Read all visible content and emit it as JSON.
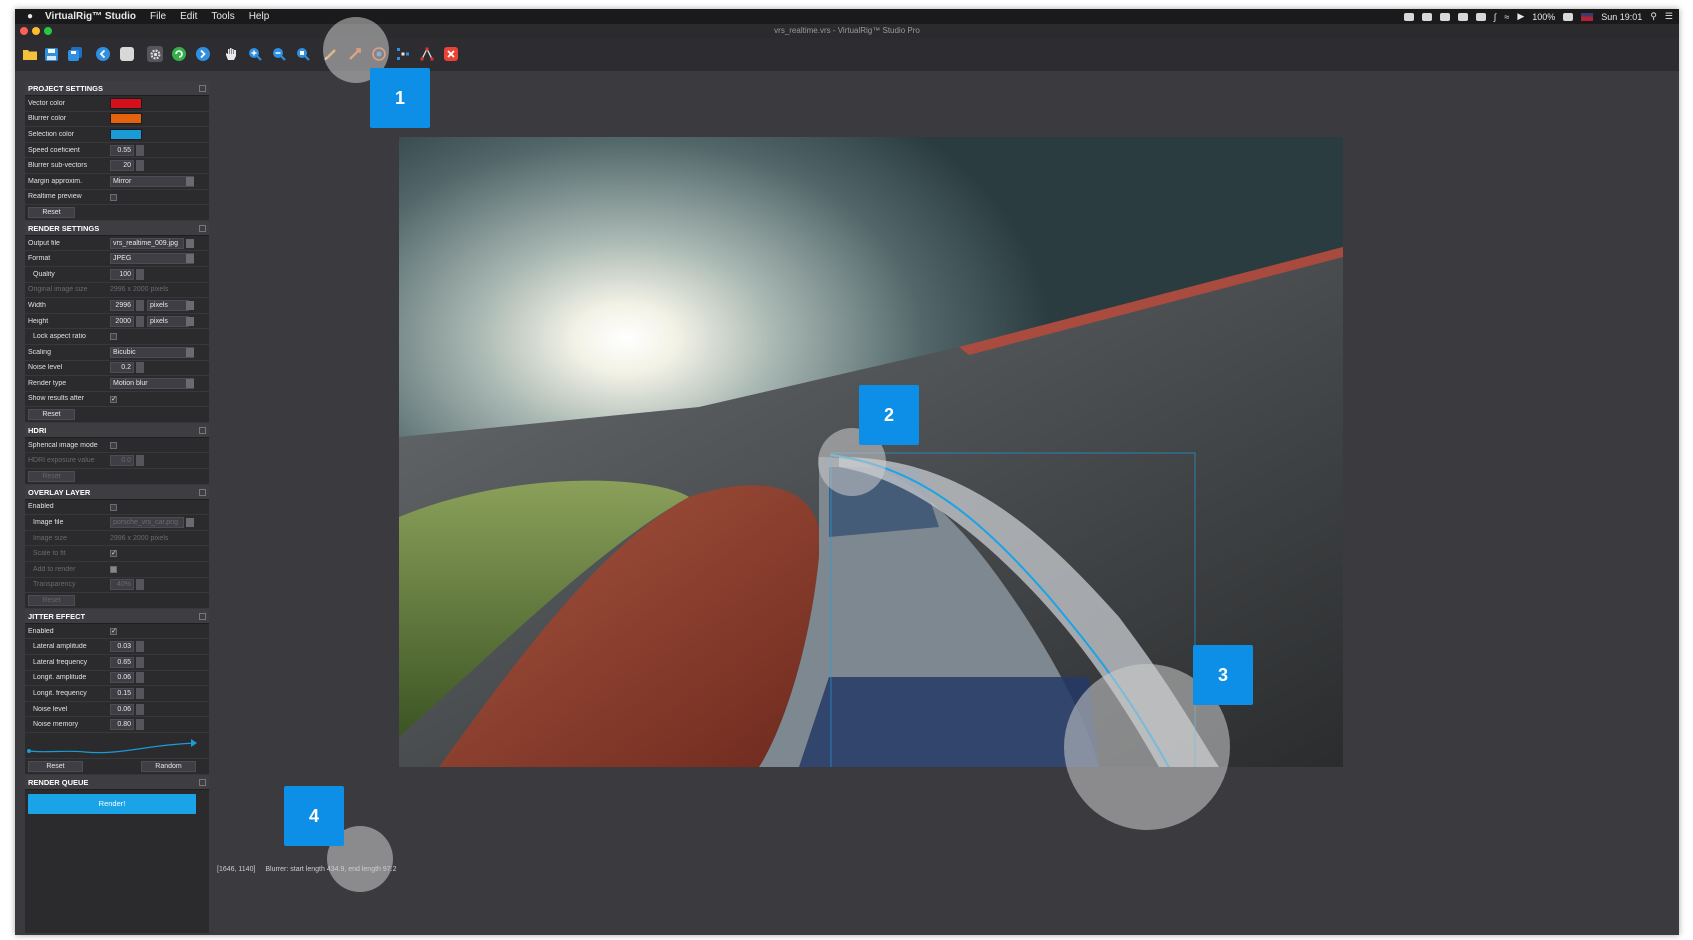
{
  "menubar": {
    "app_name": "VirtualRig™ Studio",
    "menus": [
      "File",
      "Edit",
      "Tools",
      "Help"
    ],
    "battery": "100%",
    "clock": "Sun 19:01"
  },
  "window": {
    "title": "vrs_realtime.vrs - VirtualRig™ Studio Pro"
  },
  "toolbar": {
    "tools": [
      "open-folder-icon",
      "save-icon",
      "save-as-icon",
      "undo-icon",
      "stop-icon",
      "settings-gear-icon",
      "refresh-icon",
      "export-icon",
      "hand-pan-icon",
      "zoom-in-icon",
      "zoom-out-icon",
      "zoom-fit-icon",
      "vector-pen-icon",
      "blurrer-tool-icon",
      "selection-tool-icon",
      "distribute-points-icon",
      "path-edit-icon",
      "close-icon"
    ]
  },
  "panel": {
    "project": {
      "title": "PROJECT SETTINGS",
      "vector_color_label": "Vector color",
      "vector_color": "#d4111a",
      "blurrer_color_label": "Blurrer color",
      "blurrer_color": "#e3620e",
      "selection_color_label": "Selection color",
      "selection_color": "#1a9bd8",
      "speed_label": "Speed coeficient",
      "speed_value": "0.55",
      "subvectors_label": "Blurrer sub-vectors",
      "subvectors_value": "20",
      "margin_label": "Margin approxim.",
      "margin_value": "Mirror",
      "realtime_label": "Realtime preview",
      "reset_label": "Reset"
    },
    "render": {
      "title": "RENDER SETTINGS",
      "output_label": "Output file",
      "output_value": "vrs_realtime_009.jpg",
      "format_label": "Format",
      "format_value": "JPEG",
      "quality_label": "Quality",
      "quality_value": "100",
      "orig_size_label": "Original image size",
      "orig_size_value": "2996 x 2000 pixels",
      "width_label": "Width",
      "width_value": "2996",
      "width_unit": "pixels",
      "height_label": "Height",
      "height_value": "2000",
      "height_unit": "pixels",
      "lock_label": "Lock aspect ratio",
      "scaling_label": "Scaling",
      "scaling_value": "Bicubic",
      "noise_label": "Noise level",
      "noise_value": "0.2",
      "render_type_label": "Render type",
      "render_type_value": "Motion blur",
      "show_results_label": "Show results after",
      "reset_label": "Reset"
    },
    "hdri": {
      "title": "HDRI",
      "spherical_label": "Spherical image mode",
      "exposure_label": "HDRI exposure value",
      "exposure_value": "0.0",
      "reset_label": "Reset"
    },
    "overlay": {
      "title": "OVERLAY LAYER",
      "enabled_label": "Enabled",
      "image_file_label": "Image file",
      "image_file_value": "porsche_vrs_car.png",
      "image_size_label": "Image size",
      "image_size_value": "2996 x 2000 pixels",
      "scale_label": "Scale to fit",
      "add_label": "Add to render",
      "transparency_label": "Transparency",
      "transparency_value": "40%",
      "reset_label": "Reset"
    },
    "jitter": {
      "title": "JITTER EFFECT",
      "enabled_label": "Enabled",
      "lat_amp_label": "Lateral amplitude",
      "lat_amp_value": "0.03",
      "lat_freq_label": "Lateral frequency",
      "lat_freq_value": "0.65",
      "lon_amp_label": "Longit. amplitude",
      "lon_amp_value": "0.06",
      "lon_freq_label": "Longit. frequency",
      "lon_freq_value": "0.15",
      "noise_label": "Noise level",
      "noise_value": "0.06",
      "memory_label": "Noise memory",
      "memory_value": "0.80",
      "reset_label": "Reset",
      "random_label": "Random"
    },
    "queue": {
      "title": "RENDER QUEUE",
      "render_label": "Render!"
    }
  },
  "status": {
    "coords": "[1646, 1140]",
    "message": "Blurrer: start length 434.9, end length 97.2"
  },
  "callouts": [
    "1",
    "2",
    "3",
    "4"
  ]
}
